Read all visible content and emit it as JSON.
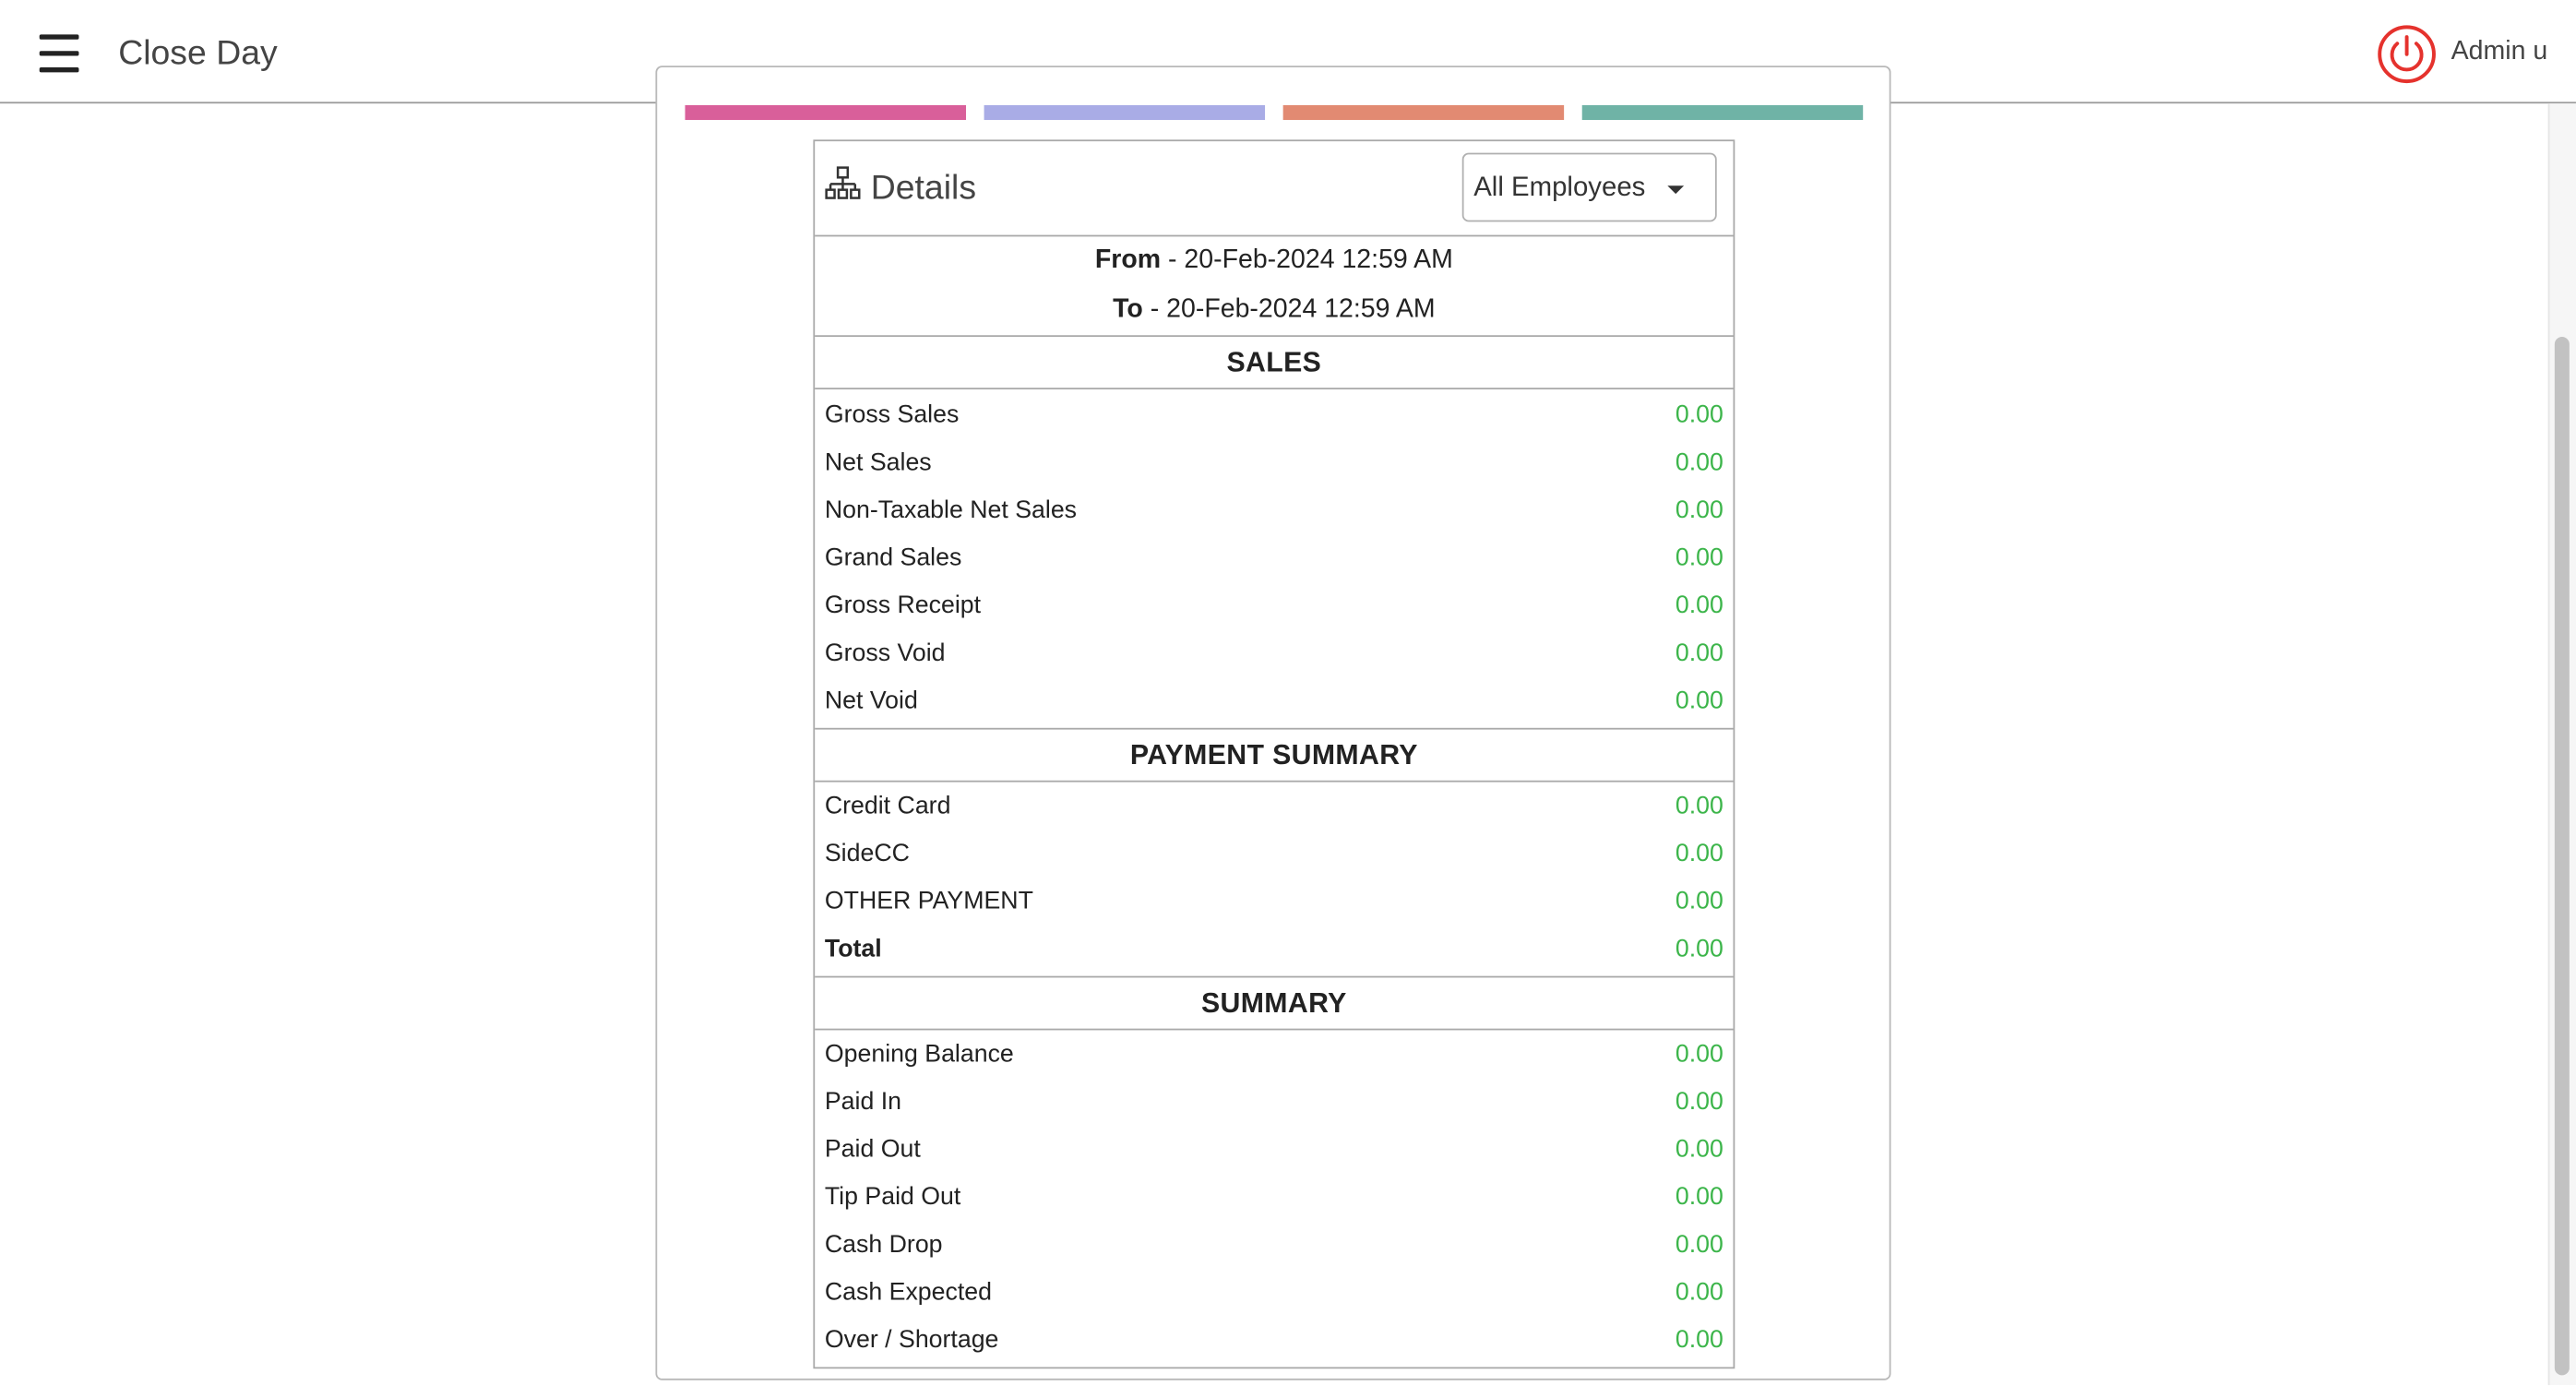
{
  "header": {
    "title": "Close Day",
    "user": "Admin u",
    "power_color": "#e5322d"
  },
  "strips": [
    {
      "color": "#d95f9a"
    },
    {
      "color": "#a9ace6"
    },
    {
      "color": "#e28a72"
    },
    {
      "color": "#6fb3a6"
    }
  ],
  "details": {
    "title": "Details",
    "employee_filter": "All Employees",
    "from_label": "From",
    "from_value": "- 20-Feb-2024 12:59 AM",
    "to_label": "To",
    "to_value": "- 20-Feb-2024 12:59 AM"
  },
  "sales": {
    "heading": "SALES",
    "rows": [
      {
        "label": "Gross Sales",
        "value": "0.00"
      },
      {
        "label": "Net Sales",
        "value": "0.00"
      },
      {
        "label": "Non-Taxable Net Sales",
        "value": "0.00"
      },
      {
        "label": "Grand Sales",
        "value": "0.00"
      },
      {
        "label": "Gross Receipt",
        "value": "0.00"
      },
      {
        "label": "Gross Void",
        "value": "0.00"
      },
      {
        "label": "Net Void",
        "value": "0.00"
      }
    ]
  },
  "payment_summary": {
    "heading": "PAYMENT SUMMARY",
    "rows": [
      {
        "label": "Credit Card",
        "value": "0.00"
      },
      {
        "label": "SideCC",
        "value": "0.00"
      },
      {
        "label": "OTHER PAYMENT",
        "value": "0.00"
      },
      {
        "label": "Total",
        "value": "0.00"
      }
    ]
  },
  "summary": {
    "heading": "SUMMARY",
    "rows": [
      {
        "label": "Opening Balance",
        "value": "0.00"
      },
      {
        "label": "Paid In",
        "value": "0.00"
      },
      {
        "label": "Paid Out",
        "value": "0.00"
      },
      {
        "label": "Tip Paid Out",
        "value": "0.00"
      },
      {
        "label": "Cash Drop",
        "value": "0.00"
      },
      {
        "label": "Cash Expected",
        "value": "0.00"
      },
      {
        "label": "Over / Shortage",
        "value": "0.00"
      }
    ]
  }
}
